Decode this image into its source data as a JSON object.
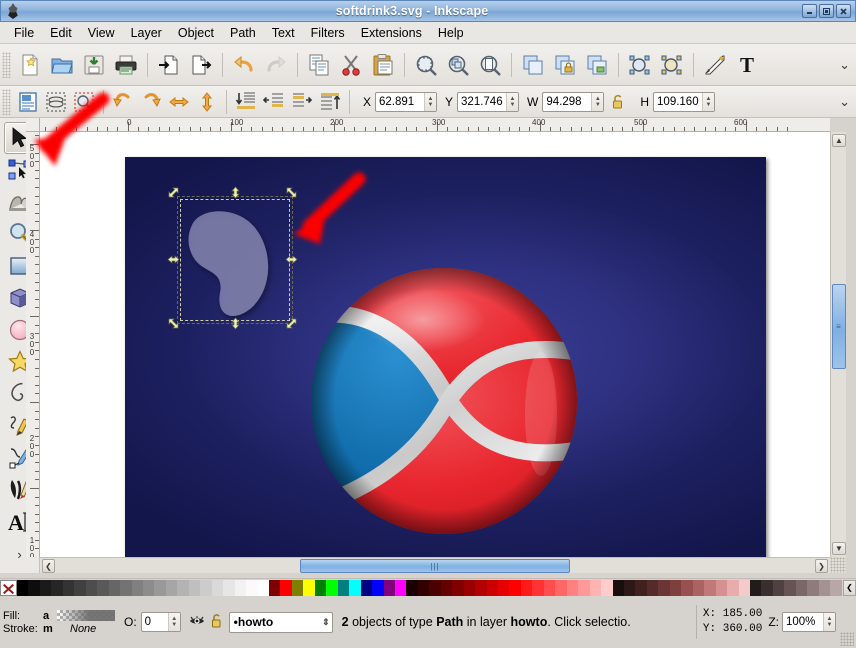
{
  "window": {
    "title": "softdrink3.svg - Inkscape",
    "app_icon": "inkscape-icon",
    "minimize": "–",
    "maximize": "▣",
    "close": "✕"
  },
  "menu": {
    "items": [
      {
        "label": "File"
      },
      {
        "label": "Edit"
      },
      {
        "label": "View"
      },
      {
        "label": "Layer"
      },
      {
        "label": "Object"
      },
      {
        "label": "Path"
      },
      {
        "label": "Text"
      },
      {
        "label": "Filters"
      },
      {
        "label": "Extensions"
      },
      {
        "label": "Help"
      }
    ]
  },
  "command_bar": {
    "buttons": [
      {
        "name": "new-document-icon",
        "tooltip": "New"
      },
      {
        "name": "open-document-icon",
        "tooltip": "Open"
      },
      {
        "name": "save-document-icon",
        "tooltip": "Save"
      },
      {
        "name": "print-document-icon",
        "tooltip": "Print"
      },
      {
        "name": "import-icon",
        "tooltip": "Import"
      },
      {
        "name": "export-icon",
        "tooltip": "Export"
      },
      {
        "name": "undo-icon",
        "tooltip": "Undo"
      },
      {
        "name": "redo-icon",
        "tooltip": "Redo"
      },
      {
        "name": "copy-icon",
        "tooltip": "Copy"
      },
      {
        "name": "cut-icon",
        "tooltip": "Cut"
      },
      {
        "name": "paste-icon",
        "tooltip": "Paste"
      },
      {
        "name": "zoom-selection-icon",
        "tooltip": "Zoom selection"
      },
      {
        "name": "zoom-drawing-icon",
        "tooltip": "Zoom drawing"
      },
      {
        "name": "zoom-page-icon",
        "tooltip": "Zoom page"
      },
      {
        "name": "duplicate-icon",
        "tooltip": "Duplicate"
      },
      {
        "name": "group-icon",
        "tooltip": "Group"
      },
      {
        "name": "ungroup-icon",
        "tooltip": "Ungroup"
      },
      {
        "name": "fill-stroke-dialog-icon",
        "tooltip": "Fill and Stroke"
      },
      {
        "name": "object-properties-icon",
        "tooltip": "Object properties"
      },
      {
        "name": "xml-editor-icon",
        "tooltip": "XML editor"
      },
      {
        "name": "text-properties-icon",
        "tooltip": "Text and font"
      }
    ],
    "overflow_chevron": "⌄"
  },
  "tool_controls": {
    "buttons": [
      {
        "name": "select-all-icon"
      },
      {
        "name": "select-all-layers-icon"
      },
      {
        "name": "deselect-icon"
      },
      {
        "name": "rotate-ccw-icon"
      },
      {
        "name": "rotate-cw-icon"
      },
      {
        "name": "flip-horizontal-icon"
      },
      {
        "name": "flip-vertical-icon"
      },
      {
        "name": "lower-to-bottom-icon"
      },
      {
        "name": "lower-icon"
      },
      {
        "name": "raise-icon"
      },
      {
        "name": "raise-to-top-icon"
      }
    ],
    "fields": [
      {
        "label": "X",
        "value": "62.891",
        "name": "x-field"
      },
      {
        "label": "Y",
        "value": "321.746",
        "name": "y-field"
      },
      {
        "label": "W",
        "value": "94.298",
        "name": "w-field"
      },
      {
        "label": "H",
        "value": "109.160",
        "name": "h-field"
      }
    ],
    "lock_icon": "lock-open-icon",
    "units_chevron": "⌄"
  },
  "toolbox": {
    "tools": [
      {
        "name": "selector-tool",
        "label": "Selector",
        "active": true
      },
      {
        "name": "node-tool",
        "label": "Node editor",
        "active": false
      },
      {
        "name": "tweak-tool",
        "label": "Tweak",
        "active": false
      },
      {
        "name": "zoom-tool",
        "label": "Zoom",
        "active": false
      },
      {
        "name": "rectangle-tool",
        "label": "Rectangle",
        "active": false
      },
      {
        "name": "box3d-tool",
        "label": "3D Box",
        "active": false
      },
      {
        "name": "ellipse-tool",
        "label": "Ellipse",
        "active": false
      },
      {
        "name": "star-tool",
        "label": "Star",
        "active": false
      },
      {
        "name": "spiral-tool",
        "label": "Spiral",
        "active": false
      },
      {
        "name": "pencil-tool",
        "label": "Pencil",
        "active": false
      },
      {
        "name": "bezier-tool",
        "label": "Bezier",
        "active": false
      },
      {
        "name": "calligraphy-tool",
        "label": "Calligraphy",
        "active": false
      },
      {
        "name": "text-tool",
        "label": "Text",
        "active": false
      },
      {
        "name": "more-tools",
        "label": "›",
        "active": false
      }
    ]
  },
  "rulers": {
    "horizontal": {
      "labels": [
        "0",
        "100",
        "200",
        "300",
        "400",
        "500",
        "600"
      ],
      "positions": [
        125,
        228,
        328,
        430,
        530,
        632,
        732
      ],
      "unit": "px"
    },
    "vertical": {
      "labels": [
        "500",
        "400",
        "300",
        "200",
        "100"
      ],
      "positions": [
        12,
        98,
        200,
        302,
        404
      ]
    }
  },
  "canvas": {
    "document_name": "softdrink3.svg",
    "selection": {
      "object_count": 2,
      "type": "Path",
      "layer": "howto"
    }
  },
  "scrollbars": {
    "vertical_thumb_label": "≡",
    "horizontal_thumb_label": "|||",
    "up_arrow": "▲",
    "down_arrow": "▼",
    "left_arrow": "❮",
    "right_arrow": "❯"
  },
  "palette": {
    "none_swatch": "X",
    "colors": [
      "#000000",
      "#0d0d0d",
      "#1a1a1a",
      "#262626",
      "#333333",
      "#404040",
      "#4d4d4d",
      "#595959",
      "#666666",
      "#737373",
      "#808080",
      "#8c8c8c",
      "#999999",
      "#a6a6a6",
      "#b3b3b3",
      "#bfbfbf",
      "#cccccc",
      "#d9d9d9",
      "#e6e6e6",
      "#f2f2f2",
      "#fafafa",
      "#ffffff",
      "#800000",
      "#ff0000",
      "#808000",
      "#ffff00",
      "#008000",
      "#00ff00",
      "#008080",
      "#00ffff",
      "#000080",
      "#0000ff",
      "#800080",
      "#ff00ff",
      "#1a0000",
      "#330000",
      "#4d0000",
      "#660000",
      "#800000",
      "#990000",
      "#b30000",
      "#cc0000",
      "#e60000",
      "#ff0000",
      "#ff1a1a",
      "#ff3333",
      "#ff4d4d",
      "#ff6666",
      "#ff8080",
      "#ff9999",
      "#ffb3b3",
      "#ffcccc",
      "#1a0d0d",
      "#2e1717",
      "#422020",
      "#552a2a",
      "#6b3535",
      "#803f3f",
      "#995050",
      "#ad6262",
      "#c27878",
      "#d69090",
      "#e8acac",
      "#f5caca",
      "#221b1b",
      "#3a2f2f",
      "#4f4141",
      "#665454",
      "#7a6767",
      "#8f7b7b",
      "#a49191",
      "#b8a7a7"
    ],
    "scroll_arrow": "❮"
  },
  "status_bar": {
    "fill_label": "Fill:",
    "fill_key": "a",
    "stroke_label": "Stroke:",
    "stroke_key": "m",
    "stroke_value": "None",
    "opacity_label": "O:",
    "opacity_value": "0",
    "layer_visibility_icon": "eye-icon",
    "layer_lock_icon": "lock-open-icon",
    "layer_name": "•howto",
    "layer_dropdown": "⇕",
    "message_prefix": "2",
    "message": " objects of type ",
    "message_type": "Path",
    "message_mid": " in layer ",
    "message_layer": "howto",
    "message_suffix": ". Click selectio.",
    "x_label": "X:",
    "x_value": "185.00",
    "y_label": "Y:",
    "y_value": "360.00",
    "zoom_label": "Z:",
    "zoom_value": "100%"
  },
  "annotations": {
    "arrow1": {
      "name": "pointer-arrow-selector-tool"
    },
    "arrow2": {
      "name": "pointer-arrow-selection-handle"
    },
    "color": "#fb0606"
  }
}
